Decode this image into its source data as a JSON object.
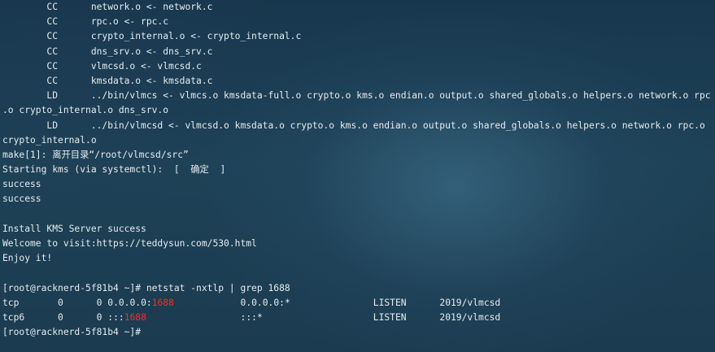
{
  "terminal": {
    "lines": [
      "        CC      network.o <- network.c",
      "        CC      rpc.o <- rpc.c",
      "        CC      crypto_internal.o <- crypto_internal.c",
      "        CC      dns_srv.o <- dns_srv.c",
      "        CC      vlmcsd.o <- vlmcsd.c",
      "        CC      kmsdata.o <- kmsdata.c",
      "        LD      ../bin/vlmcs <- vlmcs.o kmsdata-full.o crypto.o kms.o endian.o output.o shared_globals.o helpers.o network.o rpc",
      ".o crypto_internal.o dns_srv.o",
      "        LD      ../bin/vlmcsd <- vlmcsd.o kmsdata.o crypto.o kms.o endian.o output.o shared_globals.o helpers.o network.o rpc.o",
      "crypto_internal.o",
      "make[1]: 离开目录“/root/vlmcsd/src”",
      "Starting kms (via systemctl):  [  确定  ]",
      "success",
      "success",
      "",
      "Install KMS Server success",
      "Welcome to visit:https://teddysun.com/530.html",
      "Enjoy it!",
      "",
      "[root@racknerd-5f81b4 ~]# netstat -nxtlp | grep 1688"
    ],
    "netstat_rows": [
      {
        "proto": "tcp",
        "recvq": "0",
        "sendq": "0",
        "local_prefix": "0.0.0.0:",
        "local_port": "1688",
        "foreign": "0.0.0.0:*",
        "state": "LISTEN",
        "program": "2019/vlmcsd"
      },
      {
        "proto": "tcp6",
        "recvq": "0",
        "sendq": "0",
        "local_prefix": ":::",
        "local_port": "1688",
        "foreign": ":::*",
        "state": "LISTEN",
        "program": "2019/vlmcsd"
      }
    ],
    "prompt": "[root@racknerd-5f81b4 ~]# ",
    "colors": {
      "text": "#e6ecef",
      "highlight": "#ff2a2a",
      "background": "#1e4257"
    }
  }
}
